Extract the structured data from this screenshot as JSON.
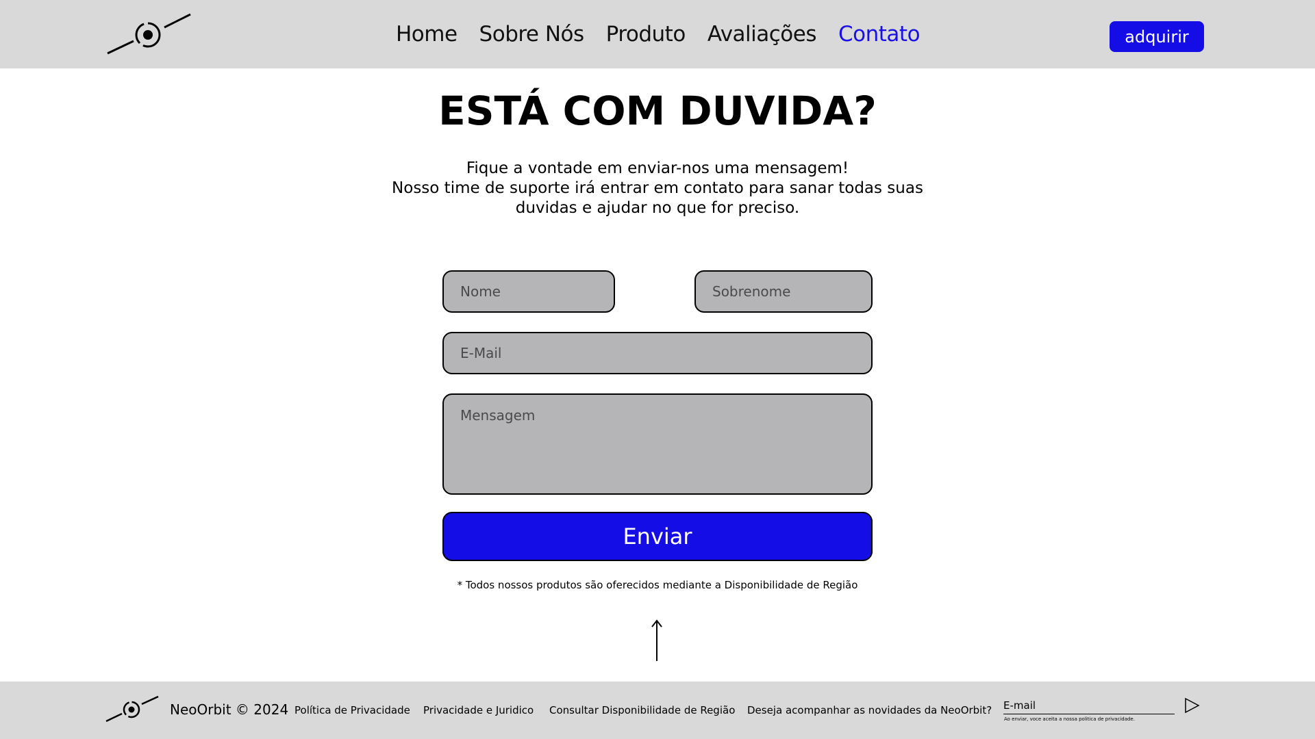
{
  "header": {
    "nav": [
      {
        "label": "Home",
        "active": false
      },
      {
        "label": "Sobre Nós",
        "active": false
      },
      {
        "label": "Produto",
        "active": false
      },
      {
        "label": "Avaliações",
        "active": false
      },
      {
        "label": "Contato",
        "active": true
      }
    ],
    "buy_label": "adquirir"
  },
  "main": {
    "title": "ESTÁ COM DUVIDA?",
    "subtitle_lines": [
      "Fique a vontade em enviar-nos uma mensagem!",
      "Nosso time de suporte irá entrar em contato para sanar todas suas",
      "duvidas e ajudar no que for preciso."
    ],
    "form": {
      "first_name_placeholder": "Nome",
      "last_name_placeholder": "Sobrenome",
      "email_placeholder": "E-Mail",
      "message_placeholder": "Mensagem",
      "submit_label": "Enviar"
    },
    "note": "* Todos nossos produtos são oferecidos mediante a Disponibilidade de Região"
  },
  "footer": {
    "brand": "NeoOrbit © 2024",
    "links": [
      "Política de Privacidade",
      "Privacidade e Juridico",
      "Consultar Disponibilidade de Região"
    ],
    "newsletter_question": "Deseja acompanhar as novidades da NeoOrbit?",
    "email_label": "E-mail",
    "fine_print": "Ao enviar, voce aceita a nossa politica de privacidade."
  },
  "colors": {
    "accent": "#150de6",
    "header_bg": "#d9d9d9",
    "field_bg": "#b5b4b6"
  },
  "icons": {
    "logo": "orbit-logo-icon",
    "scroll_top": "arrow-up-icon",
    "send": "send-triangle-icon"
  }
}
